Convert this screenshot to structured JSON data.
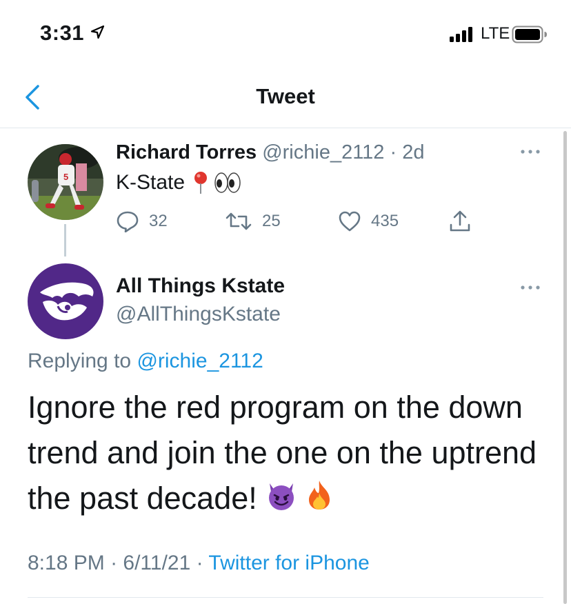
{
  "status_bar": {
    "time": "3:31",
    "network": "LTE"
  },
  "nav": {
    "title": "Tweet"
  },
  "parent_tweet": {
    "name": "Richard Torres",
    "handle": "@richie_2112",
    "separator": " · ",
    "age": "2d",
    "text": "K-State",
    "emoji": [
      "round-pushpin",
      "eyes"
    ],
    "reply_count": "32",
    "retweet_count": "25",
    "like_count": "435"
  },
  "tweet": {
    "name": "All Things Kstate",
    "handle": "@AllThingsKstate",
    "replying_label": "Replying to ",
    "replying_handle": "@richie_2112",
    "body": "Ignore the red program on the down trend and join the one on the uptrend the past decade! ",
    "emoji": [
      "smiling-imp",
      "fire"
    ],
    "time": "8:18 PM",
    "dot": " · ",
    "date": "6/11/21",
    "dot2": " · ",
    "source": "Twitter for iPhone"
  },
  "colors": {
    "link": "#1b95e0",
    "muted": "#657786",
    "kstate_purple": "#512888"
  }
}
